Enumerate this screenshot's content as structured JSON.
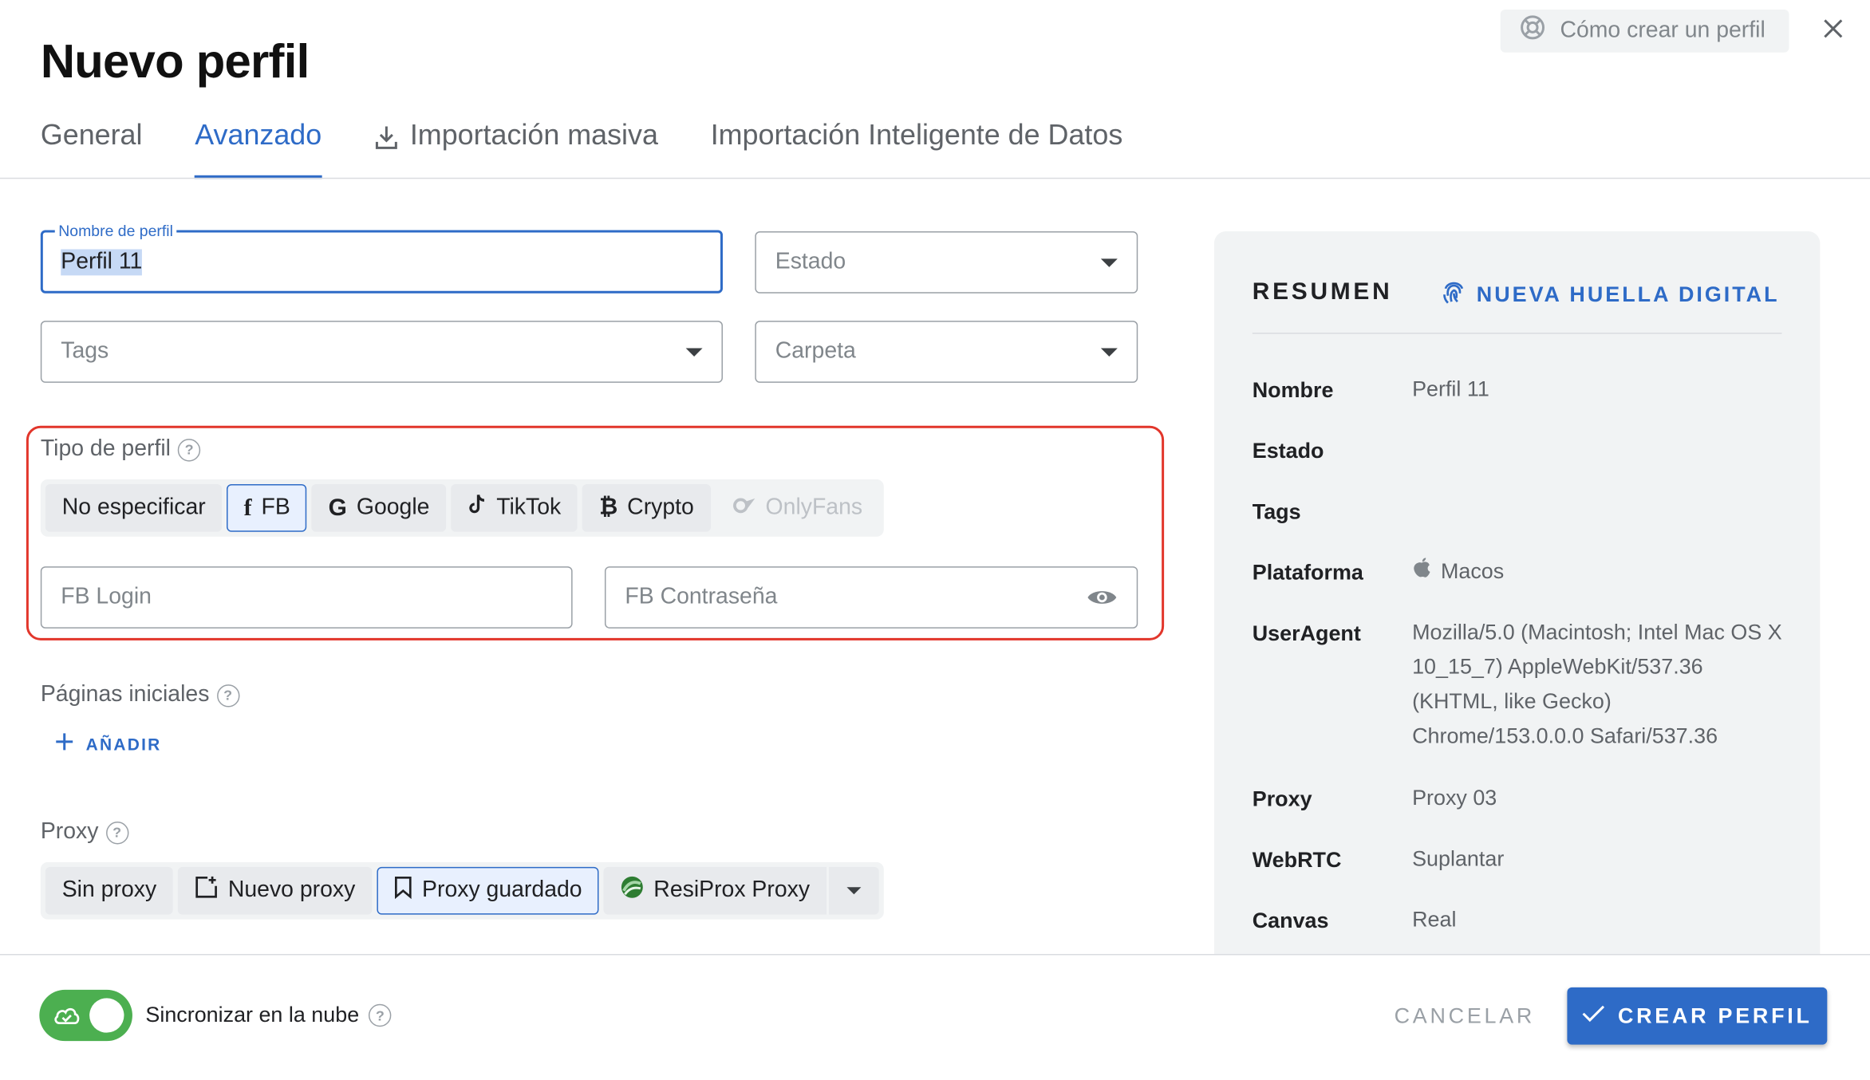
{
  "header": {
    "title": "Nuevo perfil",
    "help_label": "Cómo crear un perfil",
    "help_icon": "lifebuoy-icon",
    "close_icon": "close-icon"
  },
  "tabs": [
    {
      "label": "General",
      "active": false
    },
    {
      "label": "Avanzado",
      "active": true
    },
    {
      "label": "Importación masiva",
      "active": false,
      "icon": "download-icon"
    },
    {
      "label": "Importación Inteligente de Datos",
      "active": false
    }
  ],
  "form": {
    "name_label": "Nombre de perfil",
    "name_value": "Perfil 11",
    "status_placeholder": "Estado",
    "tags_placeholder": "Tags",
    "folder_placeholder": "Carpeta"
  },
  "profile_type": {
    "label": "Tipo de perfil",
    "options": [
      {
        "label": "No especificar",
        "selected": false,
        "disabled": false,
        "icon": ""
      },
      {
        "label": "FB",
        "selected": true,
        "disabled": false,
        "icon": "facebook-icon"
      },
      {
        "label": "Google",
        "selected": false,
        "disabled": false,
        "icon": "google-icon"
      },
      {
        "label": "TikTok",
        "selected": false,
        "disabled": false,
        "icon": "tiktok-icon"
      },
      {
        "label": "Crypto",
        "selected": false,
        "disabled": false,
        "icon": "bitcoin-icon"
      },
      {
        "label": "OnlyFans",
        "selected": false,
        "disabled": true,
        "icon": "onlyfans-icon"
      }
    ],
    "login_placeholder": "FB Login",
    "password_placeholder": "FB Contraseña"
  },
  "start_pages": {
    "label": "Páginas iniciales",
    "add_label": "AÑADIR"
  },
  "proxy": {
    "label": "Proxy",
    "options": [
      {
        "label": "Sin proxy",
        "selected": false,
        "icon": ""
      },
      {
        "label": "Nuevo proxy",
        "selected": false,
        "icon": "new-proxy-icon"
      },
      {
        "label": "Proxy guardado",
        "selected": true,
        "icon": "bookmark-icon"
      },
      {
        "label": "ResiProx Proxy",
        "selected": false,
        "icon": "resiprox-icon"
      }
    ]
  },
  "summary": {
    "title": "RESUMEN",
    "new_fingerprint": "NUEVA HUELLA DIGITAL",
    "rows": [
      {
        "key": "Nombre",
        "value": "Perfil 11"
      },
      {
        "key": "Estado",
        "value": ""
      },
      {
        "key": "Tags",
        "value": ""
      },
      {
        "key": "Plataforma",
        "value": "Macos"
      },
      {
        "key": "UserAgent",
        "value": "Mozilla/5.0 (Macintosh; Intel Mac OS X 10_15_7) AppleWebKit/537.36 (KHTML, like Gecko) Chrome/153.0.0.0 Safari/537.36"
      },
      {
        "key": "Proxy",
        "value": "Proxy 03"
      },
      {
        "key": "WebRTC",
        "value": "Suplantar"
      },
      {
        "key": "Canvas",
        "value": "Real"
      }
    ]
  },
  "footer": {
    "sync_label": "Sincronizar en la nube",
    "sync_enabled": true,
    "cancel_label": "CANCELAR",
    "create_label": "CREAR PERFIL"
  },
  "colors": {
    "accent": "#2e6bc7",
    "highlight": "#e2362b",
    "toggle_on": "#4caf50"
  }
}
